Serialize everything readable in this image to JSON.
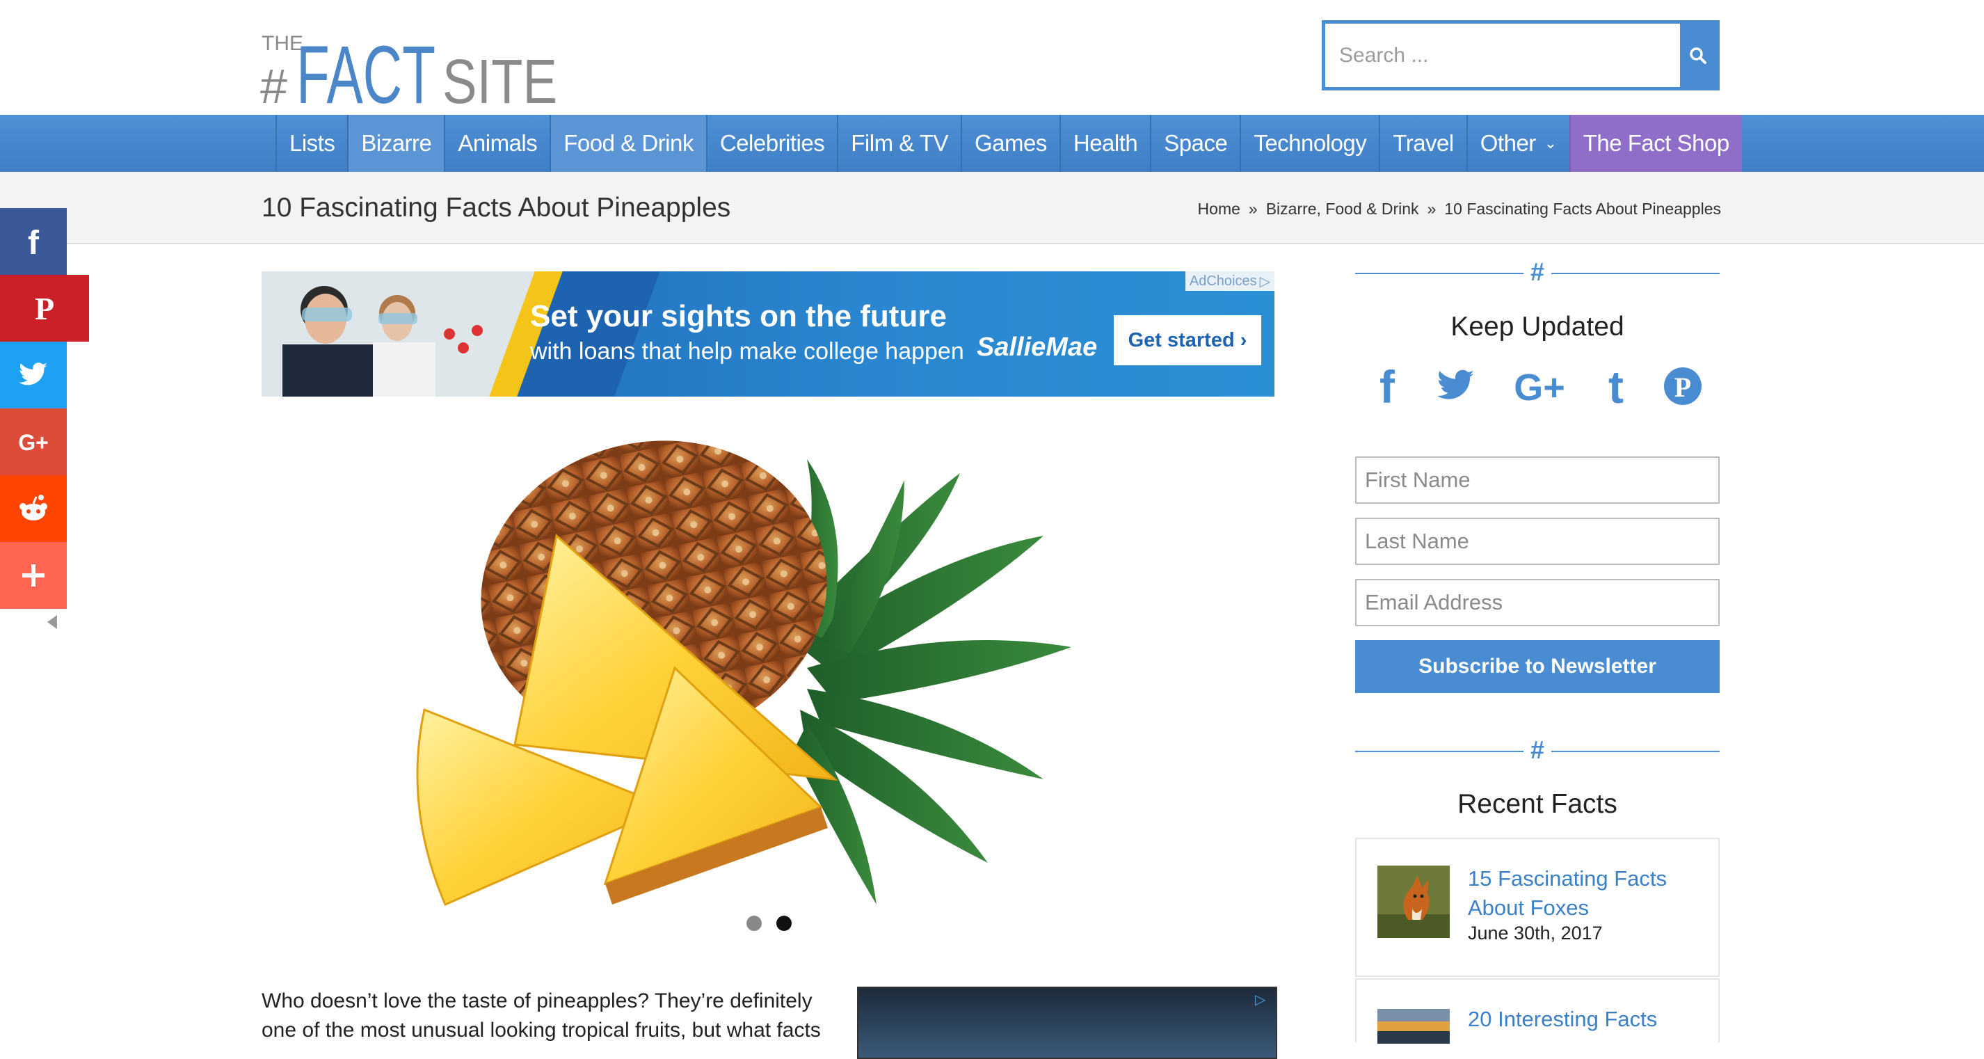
{
  "header": {
    "logo_the": "THE",
    "logo_hash": "#",
    "logo_fact": "FACT",
    "logo_site": "SITE",
    "search_placeholder": "Search ..."
  },
  "nav": {
    "items": [
      {
        "label": "Lists"
      },
      {
        "label": "Bizarre"
      },
      {
        "label": "Animals"
      },
      {
        "label": "Food & Drink"
      },
      {
        "label": "Celebrities"
      },
      {
        "label": "Film & TV"
      },
      {
        "label": "Games"
      },
      {
        "label": "Health"
      },
      {
        "label": "Space"
      },
      {
        "label": "Technology"
      },
      {
        "label": "Travel"
      },
      {
        "label": "Other"
      },
      {
        "label": "The Fact Shop"
      }
    ]
  },
  "titlebar": {
    "page_title": "10 Fascinating Facts About Pineapples",
    "breadcrumb": [
      "Home",
      "»",
      "Bizarre, Food & Drink",
      "»",
      "10 Fascinating Facts About Pineapples"
    ]
  },
  "share": [
    {
      "icon": "facebook-icon",
      "color": "#3b5998"
    },
    {
      "icon": "pinterest-icon",
      "color": "#cb2027"
    },
    {
      "icon": "twitter-icon",
      "color": "#1da1f2"
    },
    {
      "icon": "google-plus-icon",
      "color": "#dd4b39"
    },
    {
      "icon": "reddit-icon",
      "color": "#ff4500"
    },
    {
      "icon": "more-icon",
      "color": "#ff6550"
    }
  ],
  "ad": {
    "choices": "AdChoices",
    "headline": "Set your sights on the future",
    "sub": "with loans that help make college happen",
    "brand": "SallieMae",
    "cta": "Get started ›"
  },
  "hero": {
    "image_alt": "pineapple-image",
    "slides": 2,
    "active_slide": 2
  },
  "article": {
    "intro": "Who doesn’t love the taste of pineapples? They’re definitely one of the most unusual looking tropical fruits, but what facts"
  },
  "sidebar": {
    "keep_updated": "Keep Updated",
    "social": [
      "facebook-icon",
      "twitter-icon",
      "google-plus-icon",
      "tumblr-icon",
      "pinterest-icon"
    ],
    "form": {
      "first_name": "First Name",
      "last_name": "Last Name",
      "email": "Email Address",
      "subscribe": "Subscribe to Newsletter"
    },
    "recent_title": "Recent Facts",
    "recent": [
      {
        "title": "15 Fascinating Facts About Foxes",
        "date": "June 30th, 2017"
      },
      {
        "title": "20 Interesting Facts",
        "date": ""
      }
    ],
    "hash": "#"
  },
  "colors": {
    "nav_blue": "#4a8cd2",
    "shop_purple": "#8e6ec8",
    "link_blue": "#3b7fc9"
  }
}
